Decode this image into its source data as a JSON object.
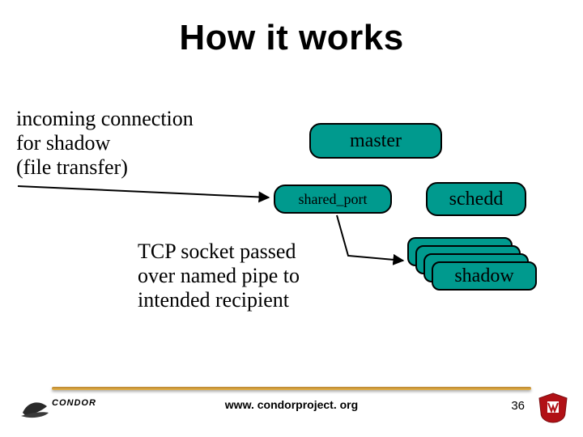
{
  "title": "How it works",
  "annotations": {
    "incoming": "incoming connection\nfor shadow\n(file transfer)",
    "tcp": "TCP socket passed\nover named pipe to\nintended recipient"
  },
  "nodes": {
    "master": "master",
    "shared_port": "shared_port",
    "schedd": "schedd",
    "shadow": "shadow"
  },
  "footer": {
    "url": "www. condorproject. org",
    "page": "36",
    "left_logo_text": "CONDOR"
  },
  "colors": {
    "node_fill": "#009a8e",
    "rule": "#c99341"
  }
}
